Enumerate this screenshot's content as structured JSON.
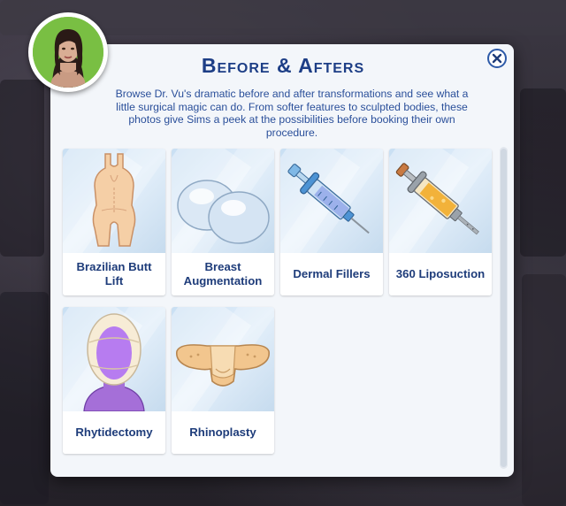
{
  "dialog": {
    "title": "Before & Afters",
    "description": "Browse Dr. Vu's dramatic before and after transformations and see what a little surgical magic can do. From softer features to sculpted bodies, these photos give Sims a peek at the possibilities before booking their own procedure.",
    "close_icon": "close-icon",
    "avatar_icon": "sim-portrait"
  },
  "procedures": [
    {
      "label": "Brazilian Butt Lift",
      "icon": "bodysuit-icon"
    },
    {
      "label": "Breast Augmentation",
      "icon": "implants-icon"
    },
    {
      "label": "Dermal Fillers",
      "icon": "syringe-icon"
    },
    {
      "label": "360 Liposuction",
      "icon": "lipo-syringe-icon"
    },
    {
      "label": "Rhytidectomy",
      "icon": "face-wrap-icon"
    },
    {
      "label": "Rhinoplasty",
      "icon": "nose-bandage-icon"
    }
  ],
  "colors": {
    "title": "#1d3e86",
    "text": "#2a4f9a",
    "panel": "#f3f6fa",
    "avatar_bg": "#7ac242"
  }
}
